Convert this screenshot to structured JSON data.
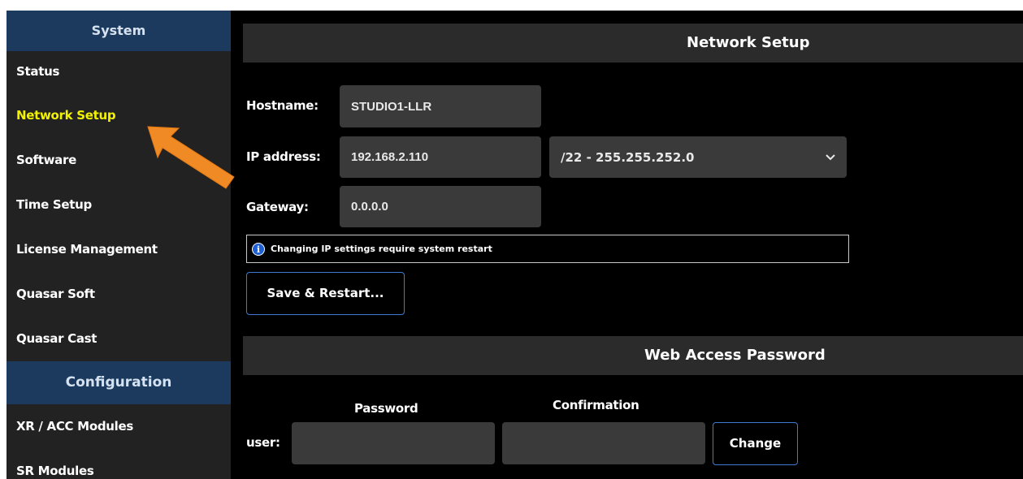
{
  "sidebar": {
    "system_header": "System",
    "config_header": "Configuration",
    "items": [
      {
        "label": "Status"
      },
      {
        "label": "Network Setup"
      },
      {
        "label": "Software"
      },
      {
        "label": "Time Setup"
      },
      {
        "label": "License Management"
      },
      {
        "label": "Quasar Soft"
      },
      {
        "label": "Quasar Cast"
      }
    ],
    "config_items": [
      {
        "label": "XR / ACC Modules"
      },
      {
        "label": "SR Modules"
      }
    ]
  },
  "network": {
    "title": "Network Setup",
    "hostname_label": "Hostname:",
    "hostname_value": "STUDIO1-LLR",
    "ip_label": "IP address:",
    "ip_value": "192.168.2.110",
    "subnet_value": "/22 - 255.255.252.0",
    "gateway_label": "Gateway:",
    "gateway_value": "0.0.0.0",
    "notice": "Changing IP settings require system restart",
    "save_button": "Save & Restart..."
  },
  "web_password": {
    "title": "Web Access Password",
    "password_header": "Password",
    "confirmation_header": "Confirmation",
    "user_label": "user:",
    "change_button": "Change"
  },
  "colors": {
    "sidebar_bg": "#222222",
    "sidebar_header_bg": "#1b3a5e",
    "active_item": "#f2f200",
    "main_bg": "#000000",
    "section_bar_bg": "#2b2b2b",
    "field_bg": "#3a3a3a",
    "button_border": "#3e7bd0",
    "annotation_arrow": "#f08a24"
  },
  "icons": {
    "info": "info-icon",
    "select": "chevron-down-icon",
    "annotation": "arrow-pointer-icon"
  }
}
